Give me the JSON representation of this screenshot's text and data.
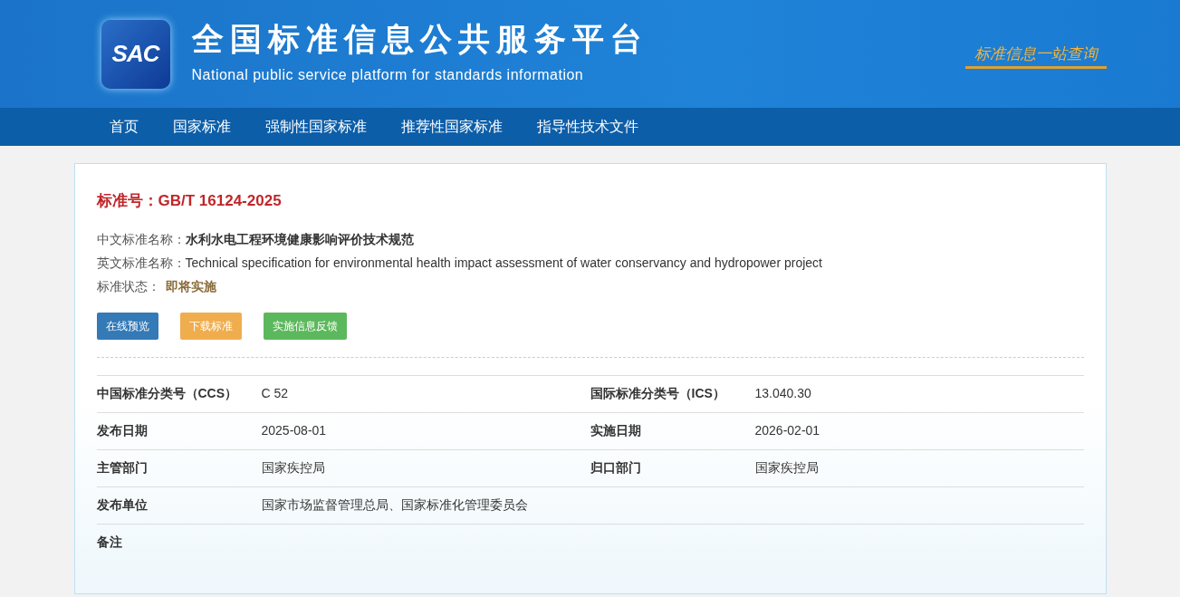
{
  "header": {
    "logo": "SAC",
    "title": "全国标准信息公共服务平台",
    "subtitle": "National public service platform  for standards information",
    "slogan": "标准信息一站查询"
  },
  "nav": [
    "首页",
    "国家标准",
    "强制性国家标准",
    "推荐性国家标准",
    "指导性技术文件"
  ],
  "standard": {
    "number_label": "标准号：",
    "number": "GB/T 16124-2025",
    "fields": [
      {
        "label": "中文标准名称：",
        "value": "水利水电工程环境健康影响评价技术规范",
        "kind": "bold"
      },
      {
        "label": "英文标准名称：",
        "value": "Technical specification for environmental health impact assessment of water conservancy and hydropower project",
        "kind": "plain"
      },
      {
        "label": "标准状态：",
        "value": "即将实施",
        "kind": "status"
      }
    ],
    "buttons": [
      {
        "label": "在线预览",
        "color": "#337ab7"
      },
      {
        "label": "下载标准",
        "color": "#f0ad4e"
      },
      {
        "label": "实施信息反馈",
        "color": "#5cb85c"
      }
    ]
  },
  "details": [
    {
      "label": "中国标准分类号（CCS）",
      "value": "C 52",
      "label_2": "国际标准分类号（ICS）",
      "value_2": "13.040.30"
    },
    {
      "label": "发布日期",
      "value": "2025-08-01",
      "label_2": "实施日期",
      "value_2": "2026-02-01"
    },
    {
      "label": "主管部门",
      "value": "国家疾控局",
      "label_2": "归口部门",
      "value_2": "国家疾控局"
    },
    {
      "label": "发布单位",
      "value": "国家市场监督管理总局、国家标准化管理委员会"
    },
    {
      "label": "备注"
    }
  ]
}
